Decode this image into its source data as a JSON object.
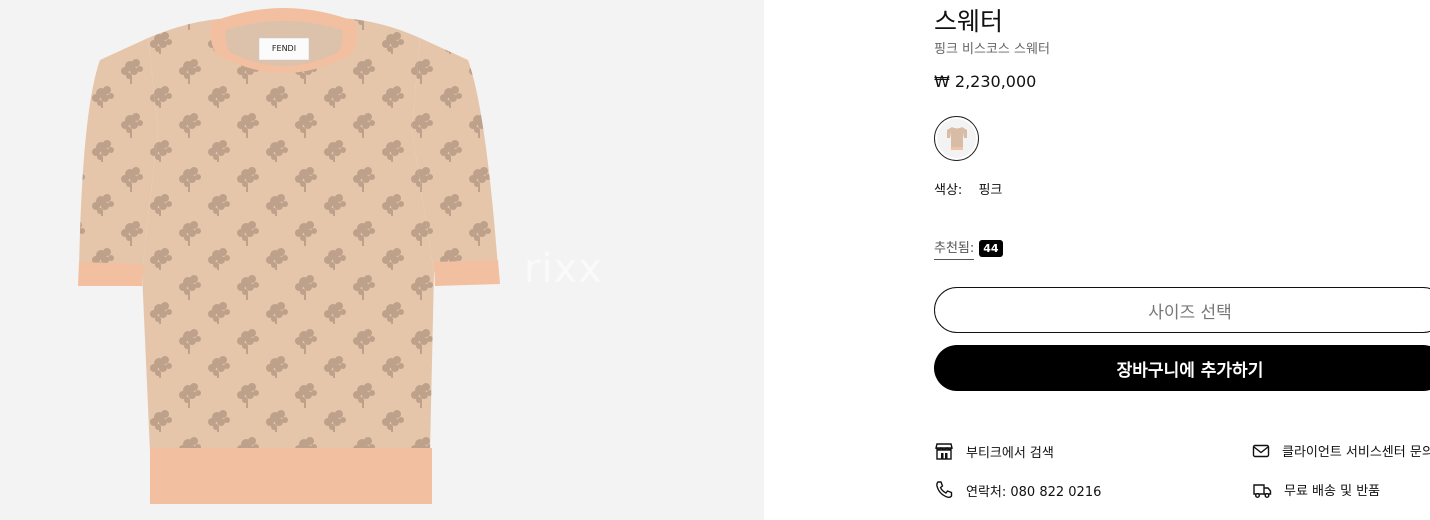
{
  "product": {
    "title": "스웨터",
    "subtitle": "핑크 비스코스 스웨터",
    "price": "₩ 2,230,000",
    "brand_label": "FENDI",
    "watermark": "rixx"
  },
  "color": {
    "label": "색상:",
    "value": "핑크"
  },
  "recommended": {
    "label": "추천됨:",
    "size": "44"
  },
  "actions": {
    "size_select": "사이즈 선택",
    "add_to_cart": "장바구니에 추가하기"
  },
  "services": {
    "boutique": "부티크에서 검색",
    "client_service": "클라이언트 서비스센터 문의",
    "contact": "연락처: 080 822 0216",
    "shipping": "무료 배송 및 반품"
  },
  "colors": {
    "image_bg": "#f3f3f3",
    "garment_base": "#e9c9ad",
    "garment_pattern": "#b79a86",
    "rib_trim": "#f2bfa0",
    "cart_button": "#000000"
  },
  "icons": [
    "boutique-icon",
    "mail-icon",
    "phone-icon",
    "truck-icon"
  ]
}
